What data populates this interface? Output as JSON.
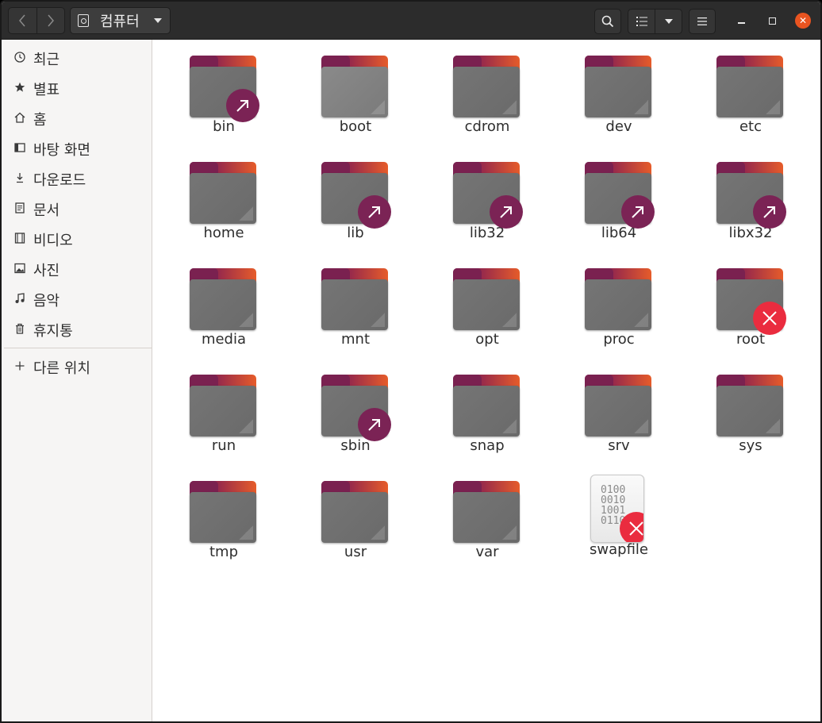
{
  "window": {
    "location_label": "컴퓨터"
  },
  "sidebar": {
    "items": [
      {
        "label": "최근",
        "icon": "clock-icon"
      },
      {
        "label": "별표",
        "icon": "star-icon"
      },
      {
        "label": "홈",
        "icon": "home-icon"
      },
      {
        "label": "바탕 화면",
        "icon": "desktop-icon"
      },
      {
        "label": "다운로드",
        "icon": "download-icon"
      },
      {
        "label": "문서",
        "icon": "document-icon"
      },
      {
        "label": "비디오",
        "icon": "video-icon"
      },
      {
        "label": "사진",
        "icon": "picture-icon"
      },
      {
        "label": "음악",
        "icon": "music-icon"
      },
      {
        "label": "휴지통",
        "icon": "trash-icon"
      }
    ],
    "other_locations": {
      "label": "다른 위치",
      "icon": "plus-icon"
    }
  },
  "files": [
    {
      "name": "bin",
      "kind": "folder",
      "emblem": "link"
    },
    {
      "name": "boot",
      "kind": "folder",
      "emblem": ""
    },
    {
      "name": "cdrom",
      "kind": "folder",
      "emblem": ""
    },
    {
      "name": "dev",
      "kind": "folder",
      "emblem": ""
    },
    {
      "name": "etc",
      "kind": "folder",
      "emblem": ""
    },
    {
      "name": "home",
      "kind": "folder",
      "emblem": ""
    },
    {
      "name": "lib",
      "kind": "folder",
      "emblem": "link"
    },
    {
      "name": "lib32",
      "kind": "folder",
      "emblem": "link"
    },
    {
      "name": "lib64",
      "kind": "folder",
      "emblem": "link"
    },
    {
      "name": "libx32",
      "kind": "folder",
      "emblem": "link"
    },
    {
      "name": "media",
      "kind": "folder",
      "emblem": ""
    },
    {
      "name": "mnt",
      "kind": "folder",
      "emblem": ""
    },
    {
      "name": "opt",
      "kind": "folder",
      "emblem": ""
    },
    {
      "name": "proc",
      "kind": "folder",
      "emblem": ""
    },
    {
      "name": "root",
      "kind": "folder",
      "emblem": "locked"
    },
    {
      "name": "run",
      "kind": "folder",
      "emblem": ""
    },
    {
      "name": "sbin",
      "kind": "folder",
      "emblem": "link"
    },
    {
      "name": "snap",
      "kind": "folder",
      "emblem": ""
    },
    {
      "name": "srv",
      "kind": "folder",
      "emblem": ""
    },
    {
      "name": "sys",
      "kind": "folder",
      "emblem": ""
    },
    {
      "name": "tmp",
      "kind": "folder",
      "emblem": ""
    },
    {
      "name": "usr",
      "kind": "folder",
      "emblem": ""
    },
    {
      "name": "var",
      "kind": "folder",
      "emblem": ""
    },
    {
      "name": "swapfile",
      "kind": "binary-file",
      "emblem": "locked"
    }
  ],
  "binary_file_glyph_lines": [
    "0100",
    "0010",
    "1001",
    "0110"
  ],
  "colors": {
    "accent": "#e95420",
    "folder_tab": "#7a2150",
    "link_emblem": "#7b2355",
    "lock_emblem": "#ea2c3f"
  }
}
